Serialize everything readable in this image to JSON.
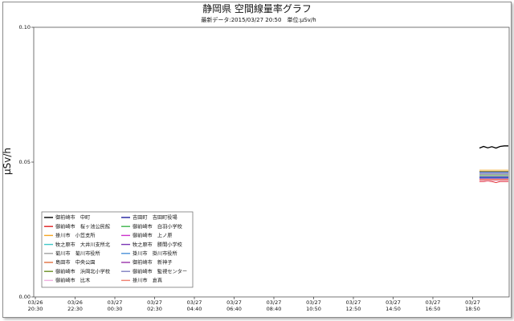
{
  "chart_data": {
    "type": "line",
    "title": "静岡県 空間線量率グラフ",
    "subtitle": "最新データ:2015/03/27 20:50　単位:μSv/h",
    "ylabel": "μSv/h",
    "xlabel": "",
    "ylim": [
      0,
      0.1
    ],
    "yticks": [
      "0.00",
      "0.05",
      "0.10"
    ],
    "x_ticks": [
      [
        "03/26",
        "20:30"
      ],
      [
        "03/26",
        "22:30"
      ],
      [
        "03/27",
        "00:30"
      ],
      [
        "03/27",
        "02:30"
      ],
      [
        "03/27",
        "04:40"
      ],
      [
        "03/27",
        "06:40"
      ],
      [
        "03/27",
        "08:40"
      ],
      [
        "03/27",
        "10:50"
      ],
      [
        "03/27",
        "12:50"
      ],
      [
        "03/27",
        "14:50"
      ],
      [
        "03/27",
        "16:50"
      ],
      [
        "03/27",
        "18:50"
      ]
    ],
    "grid": false,
    "legend_position": "bottom-left",
    "series": [
      {
        "name": "御前崎市　中町",
        "color": "#000000",
        "values": [
          0.0552,
          0.0558,
          0.0553,
          0.0557,
          0.0552,
          0.0558,
          0.056,
          0.056
        ]
      },
      {
        "name": "吉田町　吉田町役場",
        "color": "#1f1f9e",
        "values": [
          0.0445,
          0.0445,
          0.0445,
          0.0445,
          0.0445,
          0.0445,
          0.0445,
          0.0445
        ]
      },
      {
        "name": "御前崎市　桜ヶ池公民館",
        "color": "#e02020",
        "values": [
          0.0428,
          0.0428,
          0.043,
          0.0428,
          0.0424,
          0.0428,
          0.0428,
          0.0428
        ]
      },
      {
        "name": "御前崎市　白羽小学校",
        "color": "#3cb44b",
        "values": [
          0.0452,
          0.0452,
          0.0452,
          0.0452,
          0.0452,
          0.0452,
          0.0452,
          0.0452
        ]
      },
      {
        "name": "掛川市　小笠支所",
        "color": "#f5a623",
        "values": [
          0.047,
          0.047,
          0.047,
          0.047,
          0.047,
          0.047,
          0.047,
          0.047
        ]
      },
      {
        "name": "御前崎市　上ノ原",
        "color": "#cc33cc",
        "values": [
          0.0438,
          0.0438,
          0.0438,
          0.0438,
          0.0438,
          0.0438,
          0.0438,
          0.0438
        ]
      },
      {
        "name": "牧之原市　大井川支所北",
        "color": "#40c8c8",
        "values": [
          0.046,
          0.046,
          0.046,
          0.046,
          0.046,
          0.046,
          0.046,
          0.046
        ]
      },
      {
        "name": "牧之原市　勝間小学校",
        "color": "#7a35b5",
        "values": [
          0.0463,
          0.0463,
          0.0463,
          0.0463,
          0.0463,
          0.0463,
          0.0463,
          0.0463
        ]
      },
      {
        "name": "菊川市　菊川市役所",
        "color": "#a0a0a0",
        "values": [
          0.0449,
          0.0449,
          0.0449,
          0.0449,
          0.0449,
          0.0449,
          0.0449,
          0.0449
        ]
      },
      {
        "name": "掛川市　掛川市役所",
        "color": "#4a90d9",
        "values": [
          0.0442,
          0.0442,
          0.0442,
          0.0442,
          0.0442,
          0.0442,
          0.0442,
          0.0442
        ]
      },
      {
        "name": "島田市　中央公園",
        "color": "#e07040",
        "values": [
          0.0434,
          0.0434,
          0.0434,
          0.0434,
          0.0434,
          0.0434,
          0.0434,
          0.0434
        ]
      },
      {
        "name": "御前崎市　新神子",
        "color": "#9933aa",
        "values": [
          0.0456,
          0.0456,
          0.0456,
          0.0456,
          0.0456,
          0.0456,
          0.0456,
          0.0456
        ]
      },
      {
        "name": "御前崎市　浜岡北小学校",
        "color": "#6b8e23",
        "values": [
          0.0466,
          0.0466,
          0.0466,
          0.0466,
          0.0466,
          0.0466,
          0.0466,
          0.0466
        ]
      },
      {
        "name": "御前崎市　監視センター",
        "color": "#8080c0",
        "values": [
          0.044,
          0.044,
          0.044,
          0.044,
          0.044,
          0.044,
          0.044,
          0.044
        ]
      },
      {
        "name": "御前崎市　比木",
        "color": "#f0b0e0",
        "values": [
          0.0431,
          0.0431,
          0.0431,
          0.0431,
          0.0431,
          0.0431,
          0.0431,
          0.0431
        ]
      },
      {
        "name": "掛川市　倉真",
        "color": "#f08070",
        "values": [
          0.0436,
          0.0436,
          0.0436,
          0.0436,
          0.0436,
          0.0436,
          0.0436,
          0.0436
        ]
      }
    ]
  }
}
